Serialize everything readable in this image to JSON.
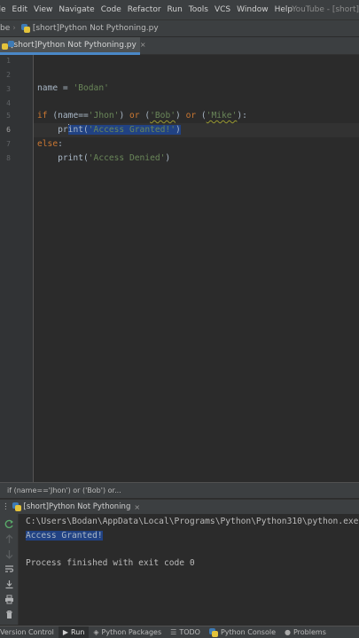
{
  "menu": {
    "items": [
      "ile",
      "Edit",
      "View",
      "Navigate",
      "Code",
      "Refactor",
      "Run",
      "Tools",
      "VCS",
      "Window",
      "Help"
    ],
    "window_title": "YouTube - [short]"
  },
  "navbar": {
    "project": "be",
    "file": "[short]Python Not Pythoning.py"
  },
  "tab": {
    "label": "[short]Python Not Pythoning.py",
    "close": "×"
  },
  "editor": {
    "line_numbers": [
      "1",
      "2",
      "3",
      "4",
      "5",
      "6",
      "7",
      "8"
    ],
    "current_line": "6",
    "lines": {
      "l3": {
        "a": "name = ",
        "b": "'Bodan'"
      },
      "l5": {
        "kw_if": "if",
        "open": " (name==",
        "s1": "'Jhon'",
        "c1": ") ",
        "or1": "or",
        "p1": " (",
        "s2": "'Bob'",
        "c2": ") ",
        "or2": "or",
        "p2": " (",
        "s3": "'Mike'",
        "end": "):"
      },
      "l6": {
        "indent": "    ",
        "pre_caret": "pr",
        "post_caret": "int(",
        "s": "'Access Granted!'",
        "close": ")"
      },
      "l7": {
        "kw_else": "else",
        "colon": ":"
      },
      "l8": {
        "indent": "    ",
        "call": "print(",
        "s": "'Access Denied'",
        "close": ")"
      }
    }
  },
  "breadcrumb": {
    "text": "if (name=='Jhon') or ('Bob') or..."
  },
  "run_panel": {
    "tab_label": "[short]Python Not Pythoning",
    "close": "×",
    "count_symbol": "⋮",
    "console": {
      "command": "C:\\Users\\Bodan\\AppData\\Local\\Programs\\Python\\Python310\\python.exe",
      "output": "Access Granted!",
      "finish": "Process finished with exit code 0"
    }
  },
  "statusbar": {
    "items": [
      "Version Control",
      "Run",
      "Python Packages",
      "TODO",
      "Python Console",
      "Problems"
    ]
  },
  "colors": {
    "keyword": "#cc7832",
    "string": "#6a8759",
    "selection": "#214283",
    "tab_accent": "#4a88c7"
  }
}
